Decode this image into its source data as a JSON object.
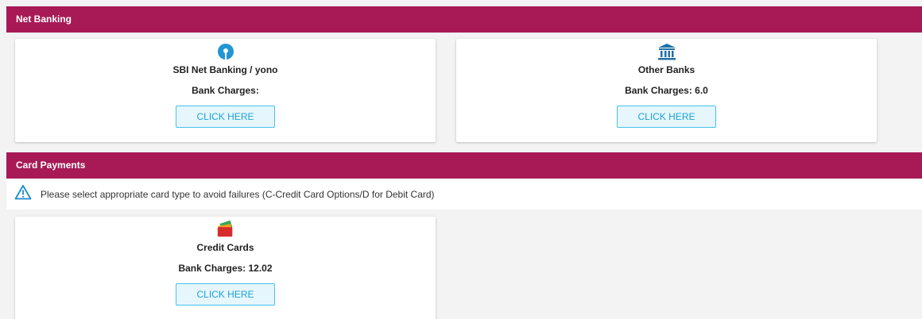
{
  "net_banking": {
    "header": "Net Banking",
    "cards": [
      {
        "icon": "sbi-logo-icon",
        "title": "SBI Net Banking / yono",
        "charges": "Bank Charges:",
        "button": "CLICK HERE"
      },
      {
        "icon": "bank-building-icon",
        "title": "Other Banks",
        "charges": "Bank Charges: 6.0",
        "button": "CLICK HERE"
      }
    ]
  },
  "card_payments": {
    "header": "Card Payments",
    "notice": "Please select appropriate card type to avoid failures (C-Credit Card Options/D for Debit Card)",
    "cards": [
      {
        "icon": "credit-cards-icon",
        "title": "Credit Cards",
        "charges": "Bank Charges: 12.02",
        "button": "CLICK HERE"
      }
    ]
  },
  "colors": {
    "header_bg": "#a71a56",
    "button_border": "#45c1ea",
    "button_text": "#1ca3d8",
    "sbi_blue": "#2196d3",
    "bank_icon": "#1f6fa5",
    "warning_icon": "#1b8bc9"
  }
}
